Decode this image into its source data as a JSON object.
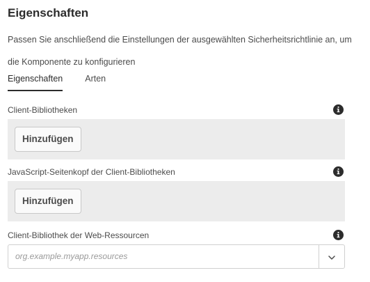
{
  "panel": {
    "title": "Eigenschaften",
    "description": "Passen Sie anschließend die Einstellungen der ausgewählten Sicherheitsrichtlinie an, um die Komponente zu konfigurieren"
  },
  "tabs": [
    {
      "label": "Eigenschaften",
      "active": true
    },
    {
      "label": "Arten",
      "active": false
    }
  ],
  "fields": {
    "client_libraries": {
      "label": "Client-Bibliotheken",
      "add_label": "Hinzufügen",
      "info_icon": "info-icon"
    },
    "js_head_libraries": {
      "label": "JavaScript-Seitenkopf der Client-Bibliotheken",
      "add_label": "Hinzufügen",
      "info_icon": "info-icon"
    },
    "web_resources_library": {
      "label": "Client-Bibliothek der Web-Ressourcen",
      "placeholder": "org.example.myapp.resources",
      "info_icon": "info-icon",
      "toggle_icon": "chevron-down-icon"
    }
  },
  "colors": {
    "text": "#4b4b4b",
    "heading": "#2c2c2c",
    "multifield_bg": "#ececec"
  }
}
